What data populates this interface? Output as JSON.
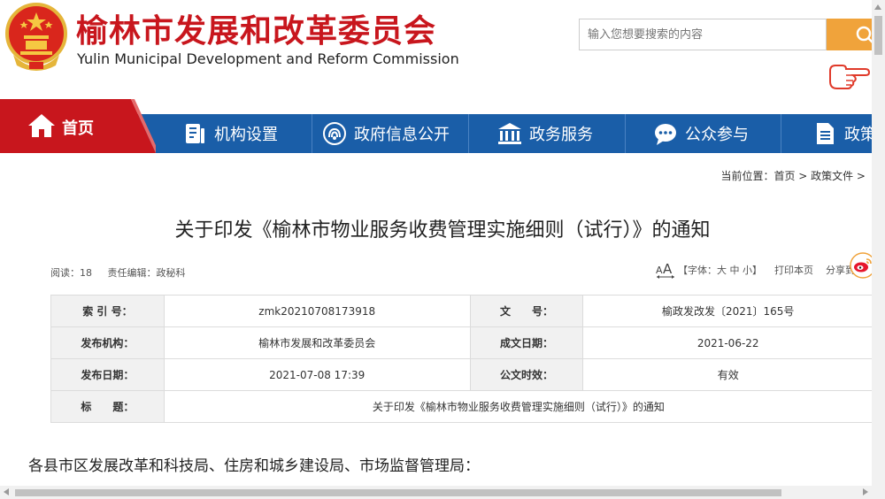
{
  "header": {
    "title_cn": "榆林市发展和改革委员会",
    "title_en": "Yulin Municipal Development and Reform Commission"
  },
  "search": {
    "placeholder": "输入您想要搜索的内容"
  },
  "nav": {
    "items": [
      {
        "label": "首页",
        "icon": "home-icon"
      },
      {
        "label": "机构设置",
        "icon": "org-icon"
      },
      {
        "label": "政府信息公开",
        "icon": "signal-icon"
      },
      {
        "label": "政务服务",
        "icon": "bank-icon"
      },
      {
        "label": "公众参与",
        "icon": "chat-icon"
      },
      {
        "label": "政策",
        "icon": "document-icon"
      }
    ]
  },
  "breadcrumb": "当前位置：首页 > 政策文件 >",
  "article": {
    "title": "关于印发《榆林市物业服务收费管理实施细则（试行）》的通知",
    "reads": "阅读：18",
    "editor": "责任编辑：政秘科",
    "font_label": "【字体：大 中 小】",
    "print_label": "打印本页",
    "share_label": "分享到："
  },
  "info": [
    {
      "k1": "索 引 号：",
      "v1": "zmk20210708173918",
      "k2": "文　　号：",
      "v2": "榆政发改发〔2021〕165号"
    },
    {
      "k1": "发布机构：",
      "v1": "榆林市发展和改革委员会",
      "k2": "成文日期：",
      "v2": "2021-06-22"
    },
    {
      "k1": "发布日期：",
      "v1": "2021-07-08 17:39",
      "k2": "公文时效：",
      "v2": "有效"
    }
  ],
  "info_title": {
    "k": "标　　题：",
    "v": "关于印发《榆林市物业服务收费管理实施细则（试行）》的通知"
  },
  "body": {
    "first_line": "各县市区发展改革和科技局、住房和城乡建设局、市场监督管理局："
  },
  "colors": {
    "brand_red": "#c8161d",
    "nav_blue": "#1a5ea8",
    "search_orange": "#f0a33b"
  }
}
